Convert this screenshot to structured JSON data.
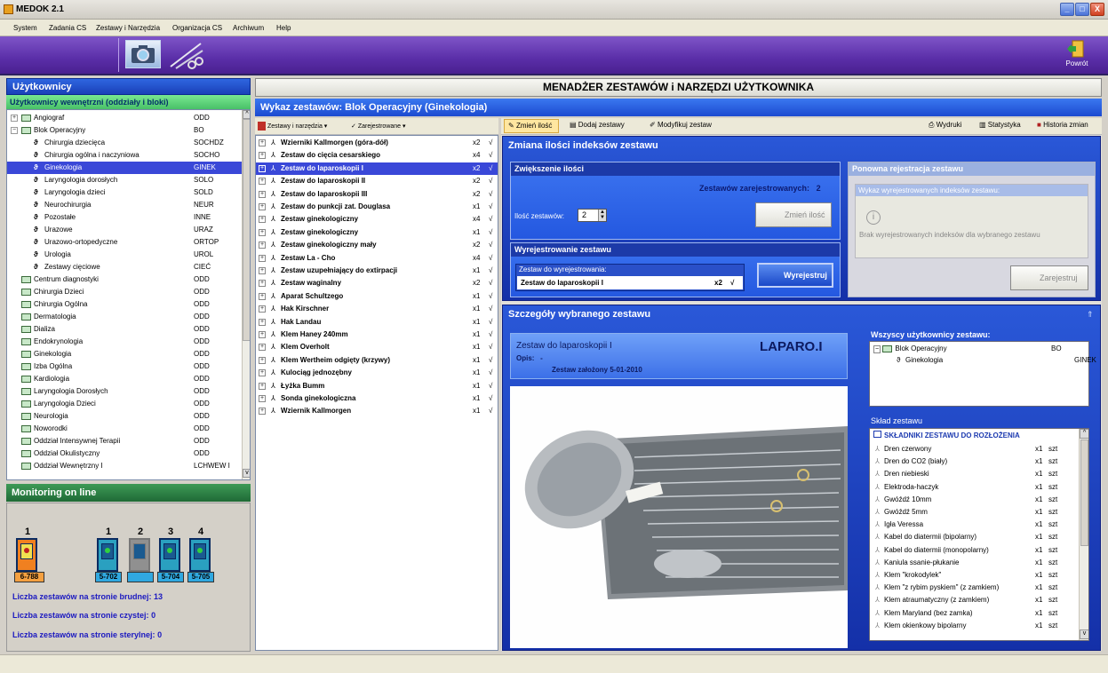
{
  "window": {
    "title": "MEDOK 2.1",
    "buttons": [
      "_",
      "□",
      "X"
    ]
  },
  "menu": [
    "System",
    "Zadania CS",
    "Zestawy i Narzędzia",
    "Organizacja CS",
    "Archiwum",
    "Help"
  ],
  "toolbar": {
    "back_label": "Powrót"
  },
  "users": {
    "title": "Użytkownicy",
    "section": "Użytkownicy wewnętrzni (oddziały i bloki)",
    "rows": [
      {
        "name": "Angiograf",
        "code": "ODD",
        "level": 0,
        "type": "box",
        "expander": "+"
      },
      {
        "name": "Blok Operacyjny",
        "code": "BO",
        "level": 0,
        "type": "box",
        "expander": "−"
      },
      {
        "name": "Chirurgia dziecięca",
        "code": "SOCHDZ",
        "level": 1,
        "type": "person"
      },
      {
        "name": "Chirurgia ogólna i naczyniowa",
        "code": "SOCHO",
        "level": 1,
        "type": "person"
      },
      {
        "name": "Ginekologia",
        "code": "GINEK",
        "level": 1,
        "type": "person",
        "selected": true
      },
      {
        "name": "Laryngologia dorosłych",
        "code": "SOLO",
        "level": 1,
        "type": "person"
      },
      {
        "name": "Laryngologia dzieci",
        "code": "SOLD",
        "level": 1,
        "type": "person"
      },
      {
        "name": "Neurochirurgia",
        "code": "NEUR",
        "level": 1,
        "type": "person"
      },
      {
        "name": "Pozostałe",
        "code": "INNE",
        "level": 1,
        "type": "person"
      },
      {
        "name": "Urazowe",
        "code": "URAZ",
        "level": 1,
        "type": "person"
      },
      {
        "name": "Urazowo-ortopedyczne",
        "code": "ORTOP",
        "level": 1,
        "type": "person"
      },
      {
        "name": "Urologia",
        "code": "UROL",
        "level": 1,
        "type": "person"
      },
      {
        "name": "Zestawy cięciowe",
        "code": "CIEĆ",
        "level": 1,
        "type": "person"
      },
      {
        "name": "Centrum diagnostyki",
        "code": "ODD",
        "level": 0,
        "type": "box"
      },
      {
        "name": "Chirurgia Dzieci",
        "code": "ODD",
        "level": 0,
        "type": "box"
      },
      {
        "name": "Chirurgia Ogólna",
        "code": "ODD",
        "level": 0,
        "type": "box"
      },
      {
        "name": "Dermatologia",
        "code": "ODD",
        "level": 0,
        "type": "box"
      },
      {
        "name": "Dializa",
        "code": "ODD",
        "level": 0,
        "type": "box"
      },
      {
        "name": "Endokrynologia",
        "code": "ODD",
        "level": 0,
        "type": "box"
      },
      {
        "name": "Ginekologia",
        "code": "ODD",
        "level": 0,
        "type": "box"
      },
      {
        "name": "Izba Ogólna",
        "code": "ODD",
        "level": 0,
        "type": "box"
      },
      {
        "name": "Kardiologia",
        "code": "ODD",
        "level": 0,
        "type": "box"
      },
      {
        "name": "Laryngologia Dorosłych",
        "code": "ODD",
        "level": 0,
        "type": "box"
      },
      {
        "name": "Laryngologia Dzieci",
        "code": "ODD",
        "level": 0,
        "type": "box"
      },
      {
        "name": "Neurologia",
        "code": "ODD",
        "level": 0,
        "type": "box"
      },
      {
        "name": "Noworodki",
        "code": "ODD",
        "level": 0,
        "type": "box"
      },
      {
        "name": "Oddział Intensywnej Terapii",
        "code": "ODD",
        "level": 0,
        "type": "box"
      },
      {
        "name": "Oddział Okulistyczny",
        "code": "ODD",
        "level": 0,
        "type": "box"
      },
      {
        "name": "Oddział Wewnętrzny I",
        "code": "LCHWEW I",
        "level": 0,
        "type": "box"
      }
    ]
  },
  "monitoring": {
    "title": "Monitoring on line",
    "cabinets": [
      {
        "num": "1",
        "label": "6-788",
        "color": "#f08020"
      },
      {
        "num": "1",
        "label": "5-702",
        "color": "#2aa0c0"
      },
      {
        "num": "2",
        "label": "",
        "color": "#909090"
      },
      {
        "num": "3",
        "label": "5-704",
        "color": "#2aa0c0"
      },
      {
        "num": "4",
        "label": "5-705",
        "color": "#2aa0c0"
      }
    ],
    "stats": [
      {
        "label": "Liczba zestawów na stronie brudnej:",
        "value": "13"
      },
      {
        "label": "Liczba zestawów na stronie czystej:",
        "value": "0"
      },
      {
        "label": "Liczba zestawów na stronie sterylnej:",
        "value": "0"
      }
    ]
  },
  "main_title": "MENADŻER ZESTAWÓW i NARZĘDZI UŻYTKOWNIKA",
  "list": {
    "title": "Wykaz zestawów: Blok Operacyjny (Ginekologia)",
    "toolbar": [
      "Zestawy i narzędzia",
      "Zarejestrowane"
    ],
    "rows": [
      {
        "name": "Wzierniki Kallmorgen (góra-dół)",
        "qty": "x2",
        "check": "√"
      },
      {
        "name": "Zestaw do cięcia cesarskiego",
        "qty": "x4",
        "check": "√"
      },
      {
        "name": "Zestaw do laparoskopii I",
        "qty": "x2",
        "check": "√",
        "selected": true
      },
      {
        "name": "Zestaw do laparoskopii II",
        "qty": "x2",
        "check": "√"
      },
      {
        "name": "Zestaw do laparoskopii III",
        "qty": "x2",
        "check": "√"
      },
      {
        "name": "Zestaw do punkcji zat. Douglasa",
        "qty": "x1",
        "check": "√"
      },
      {
        "name": "Zestaw ginekologiczny",
        "qty": "x4",
        "check": "√"
      },
      {
        "name": "Zestaw ginekologiczny",
        "qty": "x1",
        "check": "√"
      },
      {
        "name": "Zestaw ginekologiczny mały",
        "qty": "x2",
        "check": "√"
      },
      {
        "name": "Zestaw La - Cho",
        "qty": "x4",
        "check": "√"
      },
      {
        "name": "Zestaw uzupełniający do extirpacji",
        "qty": "x1",
        "check": "√"
      },
      {
        "name": "Zestaw waginalny",
        "qty": "x2",
        "check": "√"
      },
      {
        "name": "Aparat Schultzego",
        "qty": "x1",
        "check": "√"
      },
      {
        "name": "Hak Kirschner",
        "qty": "x1",
        "check": "√"
      },
      {
        "name": "Hak Landau",
        "qty": "x1",
        "check": "√"
      },
      {
        "name": "Klem Haney 240mm",
        "qty": "x1",
        "check": "√"
      },
      {
        "name": "Klem Overholt",
        "qty": "x1",
        "check": "√"
      },
      {
        "name": "Klem Wertheim odgięty (krzywy)",
        "qty": "x1",
        "check": "√"
      },
      {
        "name": "Kulociąg jednozębny",
        "qty": "x1",
        "check": "√"
      },
      {
        "name": "Łyżka Bumm",
        "qty": "x1",
        "check": "√"
      },
      {
        "name": "Sonda ginekologiczna",
        "qty": "x1",
        "check": "√"
      },
      {
        "name": "Wziernik Kallmorgen",
        "qty": "x1",
        "check": "√"
      }
    ]
  },
  "actions": {
    "buttons": [
      "Zmień ilość",
      "Dodaj zestawy",
      "Modyfikuj zestaw"
    ],
    "right": [
      "Wydruki",
      "Statystyka",
      "Historia zmian"
    ]
  },
  "change": {
    "title": "Zmiana ilości indeksów zestawu",
    "increase": {
      "title": "Zwiększenie ilości",
      "registered_label": "Zestawów zarejestrowanych:",
      "registered_value": "2",
      "qty_label": "Ilość zestawów:",
      "qty_value": "2",
      "button": "Zmień ilość"
    },
    "unregister": {
      "title": "Wyrejestrowanie zestawu",
      "field_label": "Zestaw do wyrejestrowania:",
      "field_value": "Zestaw do laparoskopii I",
      "field_qty": "x2",
      "button": "Wyrejestruj"
    },
    "reregister": {
      "title": "Ponowna rejestracja zestawu",
      "list_label": "Wykaz wyrejestrowanych indeksów zestawu:",
      "empty": "Brak wyrejestrowanych indeksów dla wybranego zestawu",
      "button": "Zarejestruj"
    }
  },
  "details": {
    "title": "Szczegóły wybranego zestawu",
    "set_name": "Zestaw do laparoskopii I",
    "code": "LAPARO.I",
    "opis_label": "Opis:",
    "opis_value": "-",
    "created": "Zestaw założony 5-01-2010",
    "users_title": "Wszyscy użytkownicy zestawu:",
    "users": [
      {
        "name": "Blok Operacyjny",
        "code": "BO"
      },
      {
        "name": "Ginekologia",
        "code": "GINEK"
      }
    ],
    "composition_title": "Skład zestawu",
    "composition_header": "SKŁADNIKI ZESTAWU DO ROZŁOŻENIA",
    "items": [
      {
        "name": "Dren czerwony",
        "qty": "x1",
        "unit": "szt"
      },
      {
        "name": "Dren do CO2 (biały)",
        "qty": "x1",
        "unit": "szt"
      },
      {
        "name": "Dren niebieski",
        "qty": "x1",
        "unit": "szt"
      },
      {
        "name": "Elektroda-haczyk",
        "qty": "x1",
        "unit": "szt"
      },
      {
        "name": "Gwóźdź 10mm",
        "qty": "x1",
        "unit": "szt"
      },
      {
        "name": "Gwóźdź 5mm",
        "qty": "x1",
        "unit": "szt"
      },
      {
        "name": "Igła Veressa",
        "qty": "x1",
        "unit": "szt"
      },
      {
        "name": "Kabel do diatermii (bipolarny)",
        "qty": "x1",
        "unit": "szt"
      },
      {
        "name": "Kabel do diatermii (monopolarny)",
        "qty": "x1",
        "unit": "szt"
      },
      {
        "name": "Kaniula ssanie-płukanie",
        "qty": "x1",
        "unit": "szt"
      },
      {
        "name": "Klem \"krokodylek\"",
        "qty": "x1",
        "unit": "szt"
      },
      {
        "name": "Klem \"z rybim pyskiem\" (z zamkiem)",
        "qty": "x1",
        "unit": "szt"
      },
      {
        "name": "Klem atraumatyczny (z zamkiem)",
        "qty": "x1",
        "unit": "szt"
      },
      {
        "name": "Klem Maryland (bez zamka)",
        "qty": "x1",
        "unit": "szt"
      },
      {
        "name": "Klem okienkowy bipolarny",
        "qty": "x1",
        "unit": "szt"
      }
    ]
  }
}
